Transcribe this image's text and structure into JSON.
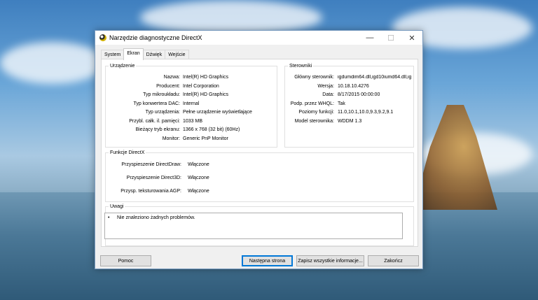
{
  "window": {
    "title": "Narzędzie diagnostyczne DirectX",
    "controls": {
      "minimize": "—",
      "maximize": "☐",
      "close": "✕"
    }
  },
  "tabs": [
    {
      "label": "System"
    },
    {
      "label": "Ekran",
      "active": true
    },
    {
      "label": "Dźwięk"
    },
    {
      "label": "Wejście"
    }
  ],
  "device": {
    "legend": "Urządzenie",
    "rows": [
      {
        "label": "Nazwa:",
        "value": "Intel(R) HD Graphics"
      },
      {
        "label": "Producent:",
        "value": "Intel Corporation"
      },
      {
        "label": "Typ mikroukładu:",
        "value": "Intel(R) HD Graphics"
      },
      {
        "label": "Typ konwertera DAC:",
        "value": "Internal"
      },
      {
        "label": "Typ urządzenia:",
        "value": "Pełne urządzenie wyświetlające"
      },
      {
        "label": "Przybl. całk. il. pamięci:",
        "value": "1033 MB"
      },
      {
        "label": "Bieżący tryb ekranu:",
        "value": "1366 x 768 (32 bit) (60Hz)"
      },
      {
        "label": "Monitor:",
        "value": "Generic PnP Monitor"
      }
    ]
  },
  "drivers": {
    "legend": "Sterowniki",
    "rows": [
      {
        "label": "Główny sterownik:",
        "value": "igdumdim64.dll,igd10iumd64.dll,ig"
      },
      {
        "label": "Wersja:",
        "value": "10.18.10.4276"
      },
      {
        "label": "Data:",
        "value": "8/17/2015 00:00:00"
      },
      {
        "label": "Podp. przez WHQL:",
        "value": "Tak"
      },
      {
        "label": "Poziomy funkcji:",
        "value": "11.0,10.1,10.0,9.3,9.2,9.1"
      },
      {
        "label": "Model sterownika:",
        "value": "WDDM 1.3"
      }
    ]
  },
  "features": {
    "legend": "Funkcje DirectX",
    "rows": [
      {
        "label": "Przyspieszenie DirectDraw:",
        "value": "Włączone"
      },
      {
        "label": "Przyspieszenie Direct3D:",
        "value": "Włączone"
      },
      {
        "label": "Przysp. teksturowania AGP:",
        "value": "Włączone"
      }
    ]
  },
  "notes": {
    "legend": "Uwagi",
    "bullet": "•",
    "message": "Nie znaleziono żadnych problemów."
  },
  "buttons": {
    "help": "Pomoc",
    "next_page": "Następna strona",
    "save_all": "Zapisz wszystkie informacje...",
    "exit": "Zakończ"
  }
}
